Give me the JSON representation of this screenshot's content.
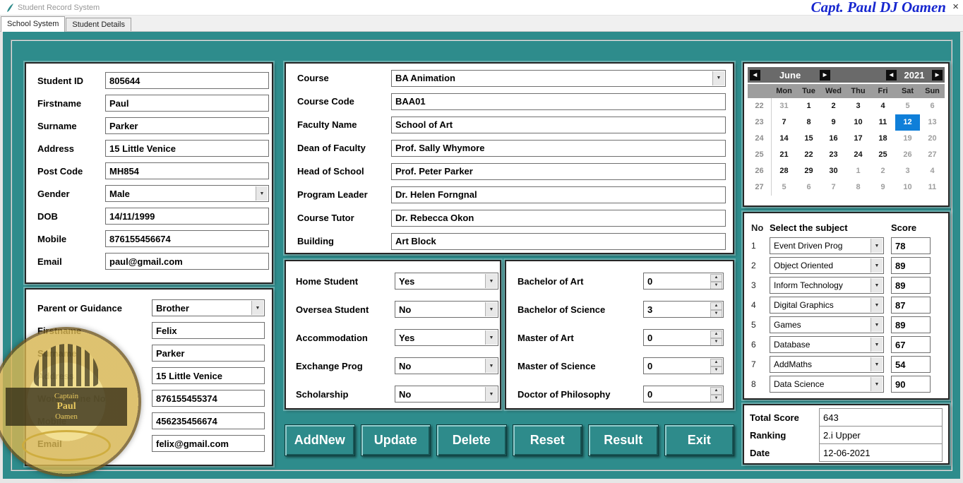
{
  "window": {
    "title": "Student Record System",
    "author": "Capt. Paul DJ Oamen"
  },
  "icons": {
    "close": "×",
    "combo_arrow": "▼",
    "spin_up": "▲",
    "spin_down": "▼",
    "cal_prev": "◀",
    "cal_next": "▶"
  },
  "colors": {
    "teal_background": "#2e8c8c",
    "button_teal": "#2e8b8b",
    "selected_day_blue": "#0f7fd9",
    "author_blue": "#1626cf"
  },
  "tabs": [
    {
      "label": "School System",
      "active": true
    },
    {
      "label": "Student Details",
      "active": false
    }
  ],
  "student_panel": {
    "fields": [
      {
        "label": "Student ID",
        "value": "805644",
        "control": "text"
      },
      {
        "label": "Firstname",
        "value": "Paul",
        "control": "text"
      },
      {
        "label": "Surname",
        "value": "Parker",
        "control": "text"
      },
      {
        "label": "Address",
        "value": "15 Little Venice",
        "control": "text"
      },
      {
        "label": "Post Code",
        "value": "MH854",
        "control": "text"
      },
      {
        "label": "Gender",
        "value": "Male",
        "control": "combo"
      },
      {
        "label": "DOB",
        "value": "14/11/1999",
        "control": "text"
      },
      {
        "label": "Mobile",
        "value": "876155456674",
        "control": "text"
      },
      {
        "label": "Email",
        "value": "paul@gmail.com",
        "control": "text"
      }
    ]
  },
  "parent_panel": {
    "fields": [
      {
        "label": "Parent or Guidance",
        "value": "Brother",
        "control": "combo"
      },
      {
        "label": "Firstname",
        "value": "Felix",
        "control": "text"
      },
      {
        "label": "Surname",
        "value": "Parker",
        "control": "text"
      },
      {
        "label": "Address",
        "value": "15 Little Venice",
        "control": "text"
      },
      {
        "label": "Work Phone No",
        "value": "876155455374",
        "control": "text"
      },
      {
        "label": "Mobile",
        "value": "456235456674",
        "control": "text"
      },
      {
        "label": "Email",
        "value": "felix@gmail.com",
        "control": "text"
      }
    ]
  },
  "course_panel": {
    "fields": [
      {
        "label": "Course",
        "value": "BA Animation",
        "control": "combo"
      },
      {
        "label": "Course Code",
        "value": "BAA01",
        "control": "text"
      },
      {
        "label": "Faculty Name",
        "value": "School of Art",
        "control": "text"
      },
      {
        "label": "Dean of Faculty",
        "value": "Prof. Sally Whymore",
        "control": "text"
      },
      {
        "label": "Head of School",
        "value": "Prof. Peter Parker",
        "control": "text"
      },
      {
        "label": "Program Leader",
        "value": "Dr. Helen Forngnal",
        "control": "text"
      },
      {
        "label": "Course Tutor",
        "value": "Dr. Rebecca Okon",
        "control": "text"
      },
      {
        "label": "Building",
        "value": "Art Block",
        "control": "text"
      }
    ]
  },
  "status_panel": {
    "fields": [
      {
        "label": "Home Student",
        "value": "Yes",
        "control": "combo"
      },
      {
        "label": "Oversea Student",
        "value": "No",
        "control": "combo"
      },
      {
        "label": "Accommodation",
        "value": "Yes",
        "control": "combo"
      },
      {
        "label": "Exchange Prog",
        "value": "No",
        "control": "combo"
      },
      {
        "label": "Scholarship",
        "value": "No",
        "control": "combo"
      }
    ]
  },
  "degree_panel": {
    "fields": [
      {
        "label": "Bachelor of Art",
        "value": "0",
        "control": "spin"
      },
      {
        "label": "Bachelor of Science",
        "value": "3",
        "control": "spin"
      },
      {
        "label": "Master of Art",
        "value": "0",
        "control": "spin"
      },
      {
        "label": "Master of Science",
        "value": "0",
        "control": "spin"
      },
      {
        "label": "Doctor of Philosophy",
        "value": "0",
        "control": "spin"
      }
    ]
  },
  "buttons": [
    "AddNew",
    "Update",
    "Delete",
    "Reset",
    "Result",
    "Exit"
  ],
  "calendar": {
    "month": "June",
    "year": "2021",
    "selected_day": "12",
    "day_headers": [
      "Mon",
      "Tue",
      "Wed",
      "Thu",
      "Fri",
      "Sat",
      "Sun"
    ],
    "weeks": [
      {
        "num": "22",
        "days": [
          {
            "d": "31",
            "s": "m"
          },
          {
            "d": "1",
            "s": "n"
          },
          {
            "d": "2",
            "s": "n"
          },
          {
            "d": "3",
            "s": "n"
          },
          {
            "d": "4",
            "s": "n"
          },
          {
            "d": "5",
            "s": "m"
          },
          {
            "d": "6",
            "s": "m"
          }
        ]
      },
      {
        "num": "23",
        "days": [
          {
            "d": "7",
            "s": "n"
          },
          {
            "d": "8",
            "s": "n"
          },
          {
            "d": "9",
            "s": "n"
          },
          {
            "d": "10",
            "s": "n"
          },
          {
            "d": "11",
            "s": "n"
          },
          {
            "d": "12",
            "s": "sel"
          },
          {
            "d": "13",
            "s": "m"
          }
        ]
      },
      {
        "num": "24",
        "days": [
          {
            "d": "14",
            "s": "n"
          },
          {
            "d": "15",
            "s": "n"
          },
          {
            "d": "16",
            "s": "n"
          },
          {
            "d": "17",
            "s": "n"
          },
          {
            "d": "18",
            "s": "n"
          },
          {
            "d": "19",
            "s": "m"
          },
          {
            "d": "20",
            "s": "m"
          }
        ]
      },
      {
        "num": "25",
        "days": [
          {
            "d": "21",
            "s": "n"
          },
          {
            "d": "22",
            "s": "n"
          },
          {
            "d": "23",
            "s": "n"
          },
          {
            "d": "24",
            "s": "n"
          },
          {
            "d": "25",
            "s": "n"
          },
          {
            "d": "26",
            "s": "m"
          },
          {
            "d": "27",
            "s": "m"
          }
        ]
      },
      {
        "num": "26",
        "days": [
          {
            "d": "28",
            "s": "n"
          },
          {
            "d": "29",
            "s": "n"
          },
          {
            "d": "30",
            "s": "n"
          },
          {
            "d": "1",
            "s": "m"
          },
          {
            "d": "2",
            "s": "m"
          },
          {
            "d": "3",
            "s": "m"
          },
          {
            "d": "4",
            "s": "m"
          }
        ]
      },
      {
        "num": "27",
        "days": [
          {
            "d": "5",
            "s": "m"
          },
          {
            "d": "6",
            "s": "m"
          },
          {
            "d": "7",
            "s": "m"
          },
          {
            "d": "8",
            "s": "m"
          },
          {
            "d": "9",
            "s": "m"
          },
          {
            "d": "10",
            "s": "m"
          },
          {
            "d": "11",
            "s": "m"
          }
        ]
      }
    ]
  },
  "subjects": {
    "headers": {
      "no": "No",
      "subject": "Select the subject",
      "score": "Score"
    },
    "rows": [
      {
        "no": "1",
        "subject": "Event Driven Prog",
        "score": "78"
      },
      {
        "no": "2",
        "subject": "Object Oriented",
        "score": "89"
      },
      {
        "no": "3",
        "subject": "Inform Technology",
        "score": "89"
      },
      {
        "no": "4",
        "subject": "Digital Graphics",
        "score": "87"
      },
      {
        "no": "5",
        "subject": "Games",
        "score": "89"
      },
      {
        "no": "6",
        "subject": "Database",
        "score": "67"
      },
      {
        "no": "7",
        "subject": "AddMaths",
        "score": "54"
      },
      {
        "no": "8",
        "subject": "Data Science",
        "score": "90"
      }
    ]
  },
  "summary": {
    "rows": [
      {
        "label": "Total Score",
        "value": "643"
      },
      {
        "label": "Ranking",
        "value": "2.i Upper"
      },
      {
        "label": "Date",
        "value": "12-06-2021"
      }
    ]
  },
  "watermark": {
    "line1": "Captain",
    "line2": "Paul",
    "line3": "Oamen"
  }
}
